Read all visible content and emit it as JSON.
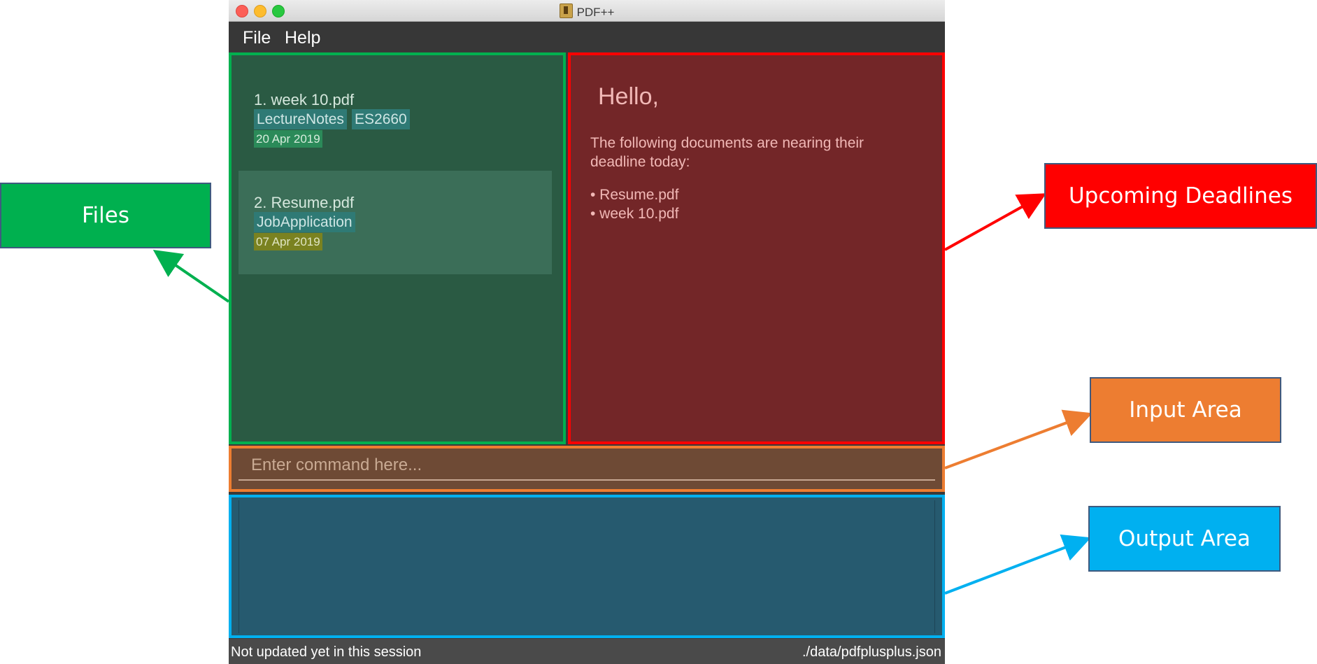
{
  "window": {
    "title": "PDF++"
  },
  "menu": {
    "file_label": "File",
    "help_label": "Help"
  },
  "files": [
    {
      "index_name": "1.  week 10.pdf",
      "tags": [
        "LectureNotes",
        "ES2660"
      ],
      "date": "20 Apr 2019",
      "date_color": "#2b8a59"
    },
    {
      "index_name": "2.  Resume.pdf",
      "tags": [
        "JobApplication"
      ],
      "date": "07 Apr 2019",
      "date_color": "#7a8220"
    }
  ],
  "deadlines": {
    "greeting": "Hello,",
    "message": "The following documents are nearing their deadline today:",
    "items": [
      "• Resume.pdf",
      "• week 10.pdf"
    ]
  },
  "command": {
    "placeholder": "Enter command here...",
    "value": ""
  },
  "status": {
    "sync": "Not updated yet in this session",
    "path": "./data/pdfplusplus.json"
  },
  "annotations": {
    "files": "Files",
    "deadlines": "Upcoming Deadlines",
    "input": "Input Area",
    "output": "Output Area"
  },
  "colors": {
    "files": "#00b04f",
    "deadlines": "#ff0000",
    "input": "#ed7d31",
    "output": "#00b0f0"
  }
}
